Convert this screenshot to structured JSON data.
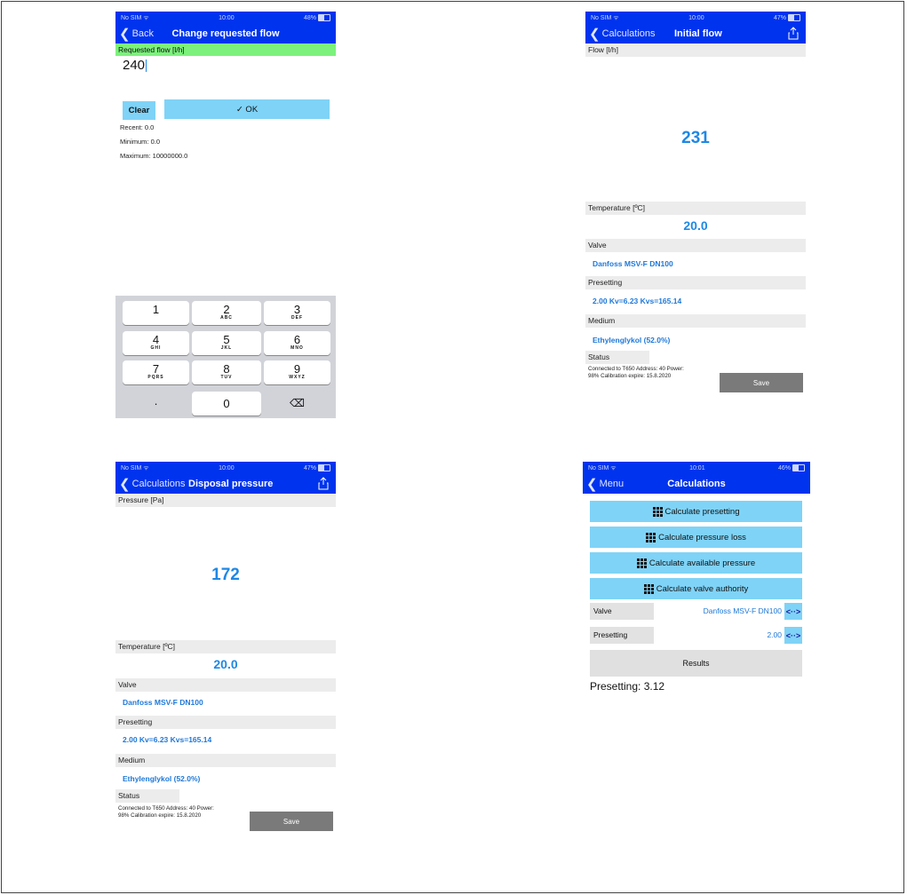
{
  "status": {
    "carrier": "No SIM",
    "screen1": {
      "time": "10:00",
      "battery": "48%"
    },
    "screen2": {
      "time": "10:00",
      "battery": "47%"
    },
    "screen3": {
      "time": "10:00",
      "battery": "47%"
    },
    "screen4": {
      "time": "10:01",
      "battery": "46%"
    }
  },
  "screen1": {
    "back": "Back",
    "title": "Change requested flow",
    "header": "Requested flow [l/h]",
    "value": "240",
    "clear": "Clear",
    "ok": "✓ OK",
    "recent": "Recent: 0.0",
    "minimum": "Minimum: 0.0",
    "maximum": "Maximum: 10000000.0",
    "keys": [
      {
        "d": "1",
        "l": ""
      },
      {
        "d": "2",
        "l": "ABC"
      },
      {
        "d": "3",
        "l": "DEF"
      },
      {
        "d": "4",
        "l": "GHI"
      },
      {
        "d": "5",
        "l": "JKL"
      },
      {
        "d": "6",
        "l": "MNO"
      },
      {
        "d": "7",
        "l": "PQRS"
      },
      {
        "d": "8",
        "l": "TUV"
      },
      {
        "d": "9",
        "l": "WXYZ"
      },
      {
        "d": ".",
        "l": ""
      },
      {
        "d": "0",
        "l": ""
      },
      {
        "d": "⌫",
        "l": ""
      }
    ]
  },
  "screen2": {
    "back": "Calculations",
    "title": "Initial flow",
    "header": "Flow [l/h]",
    "value": "231",
    "temp_label": "Temperature [ºC]",
    "temp_value": "20.0",
    "valve_label": "Valve",
    "valve_value": "Danfoss MSV-F  DN100",
    "presetting_label": "Presetting",
    "presetting_value": "2.00 Kv=6.23 Kvs=165.14",
    "medium_label": "Medium",
    "medium_value": "Ethylenglykol (52.0%)",
    "status_label": "Status",
    "status_line1": "Connected to T650 Address: 40 Power:",
    "status_line2": "98% Calibration expire: 15.8.2020",
    "save": "Save"
  },
  "screen3": {
    "back": "Calculations",
    "title": "Disposal pressure",
    "header": "Pressure [Pa]",
    "value": "172",
    "temp_label": "Temperature [ºC]",
    "temp_value": "20.0",
    "valve_label": "Valve",
    "valve_value": "Danfoss MSV-F  DN100",
    "presetting_label": "Presetting",
    "presetting_value": "2.00 Kv=6.23 Kvs=165.14",
    "medium_label": "Medium",
    "medium_value": "Ethylenglykol (52.0%)",
    "status_label": "Status",
    "status_line1": "Connected to T650 Address: 40 Power:",
    "status_line2": "98% Calibration expire: 15.8.2020",
    "save": "Save"
  },
  "screen4": {
    "back": "Menu",
    "title": "Calculations",
    "btn1": "Calculate presetting",
    "btn2": "Calculate pressure loss",
    "btn3": "Calculate available pressure",
    "btn4": "Calculate valve authority",
    "valve_label": "Valve",
    "valve_value": "Danfoss MSV-F  DN100",
    "presetting_label": "Presetting",
    "presetting_value": "2.00",
    "swap": "<··>",
    "results": "Results",
    "result_text": "Presetting: 3.12"
  },
  "colors": {
    "nav": "#0033ee",
    "accent": "#1e88e5",
    "button": "#7fd3f7",
    "header_green": "#7cf27c"
  },
  "icons": [
    "back-chevron-icon",
    "share-icon",
    "grid-icon",
    "backspace-icon",
    "wifi-icon",
    "battery-icon"
  ]
}
